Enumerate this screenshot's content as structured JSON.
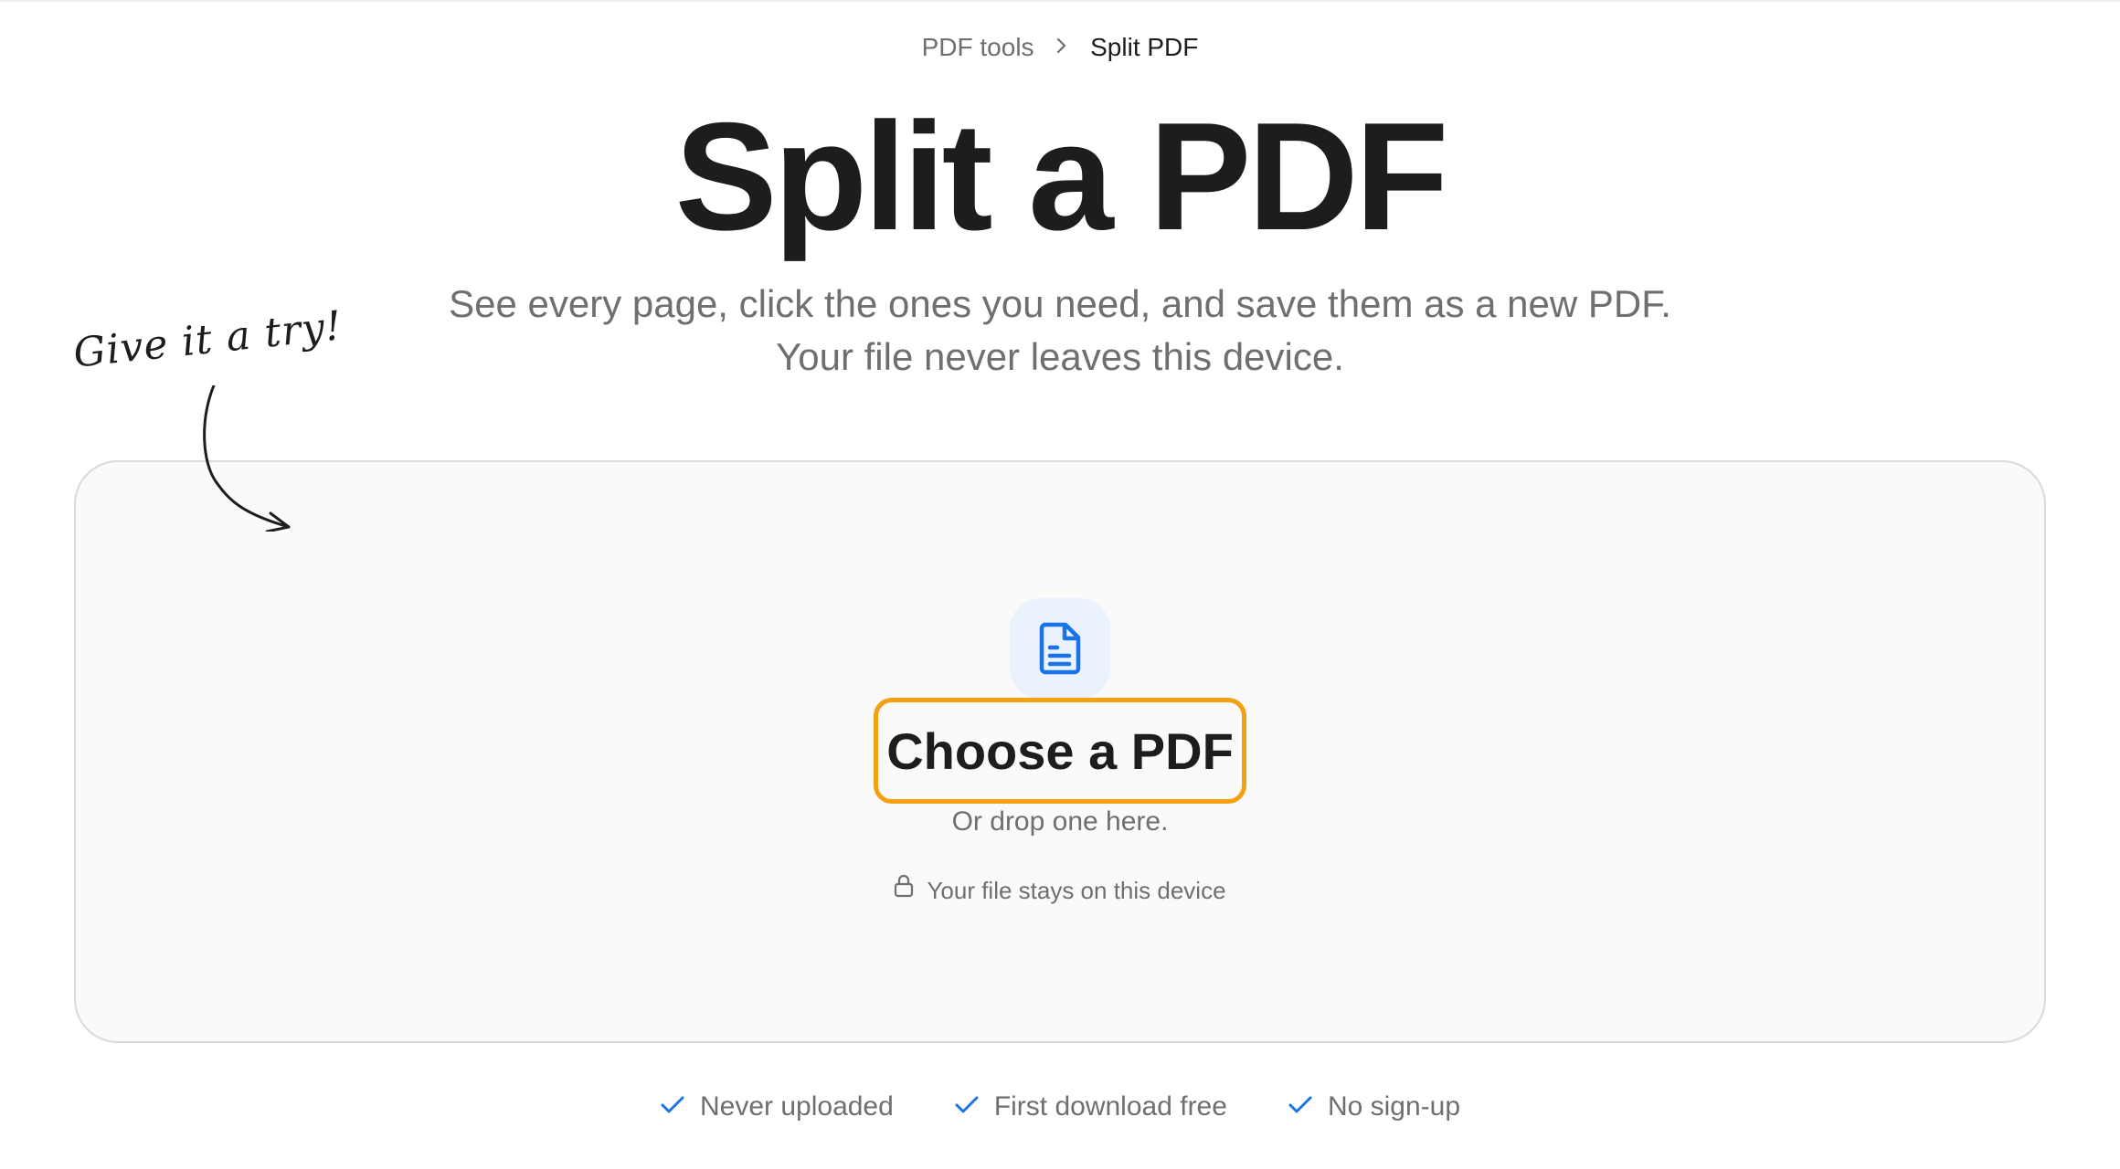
{
  "breadcrumb": {
    "parent": "PDF tools",
    "current": "Split PDF"
  },
  "hero": {
    "title": "Split a PDF",
    "subtitle_line1": "See every page, click the ones you need, and save them as a new PDF.",
    "subtitle_line2": "Your file never leaves this device."
  },
  "hint": {
    "text": "Give it a try!"
  },
  "dropzone": {
    "icon": "file-text-icon",
    "button_label": "Choose a PDF",
    "drop_text": "Or drop one here.",
    "privacy_icon": "lock-icon",
    "privacy_text": "Your file stays on this device"
  },
  "features": [
    {
      "icon": "check-icon",
      "label": "Never uploaded"
    },
    {
      "icon": "check-icon",
      "label": "First download free"
    },
    {
      "icon": "check-icon",
      "label": "No sign-up"
    }
  ],
  "colors": {
    "accent_blue": "#1a73e8",
    "button_outline": "#f5a011",
    "text_primary": "#1d1d1f",
    "text_secondary": "#6e6e73",
    "dropzone_bg": "#fafafb",
    "icon_badge_bg": "#eaf2fd"
  }
}
